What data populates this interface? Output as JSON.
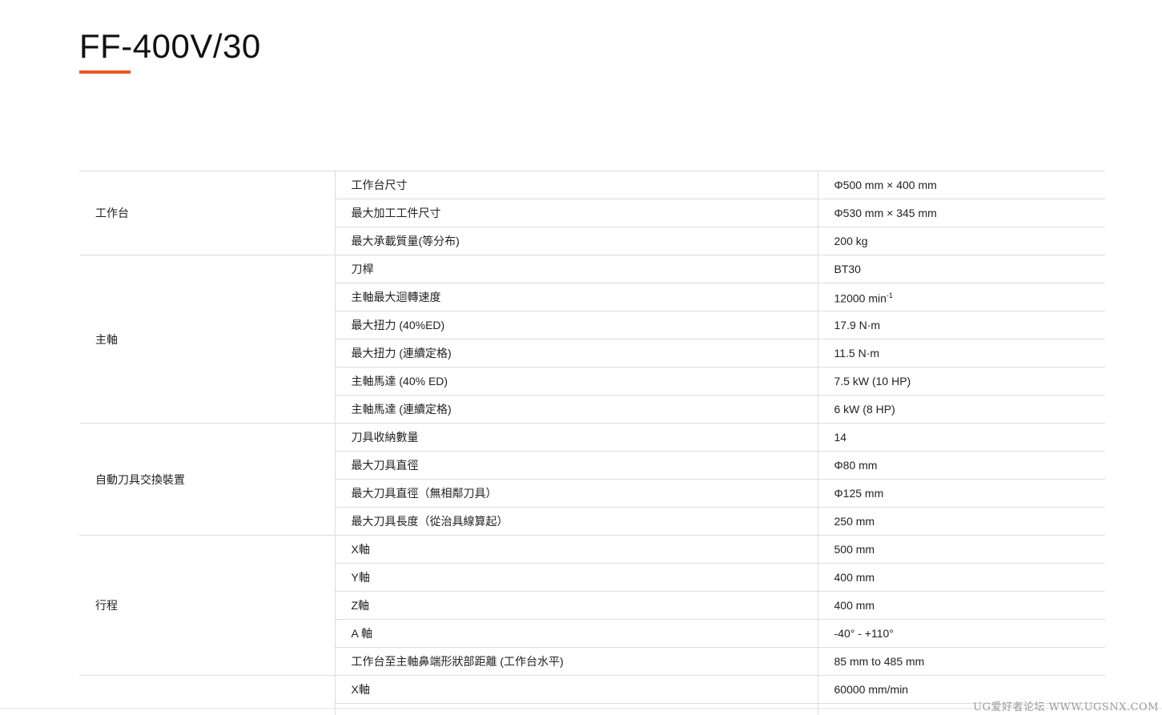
{
  "page": {
    "title": "FF-400V/30",
    "accent_color": "#e8581e"
  },
  "spec_table": {
    "groups": [
      {
        "category": "工作台",
        "rows": [
          {
            "item": "工作台尺寸",
            "value": "Φ500 mm × 400 mm"
          },
          {
            "item": "最大加工工件尺寸",
            "value": "Φ530 mm × 345 mm"
          },
          {
            "item": "最大承載質量(等分布)",
            "value": "200 kg"
          }
        ]
      },
      {
        "category": "主軸",
        "rows": [
          {
            "item": "刀桿",
            "value": "BT30"
          },
          {
            "item": "主軸最大迴轉速度",
            "value": "12000 min",
            "sup": "-1"
          },
          {
            "item": "最大扭力 (40%ED)",
            "value": "17.9 N·m"
          },
          {
            "item": "最大扭力 (連續定格)",
            "value": "11.5 N·m"
          },
          {
            "item": "主軸馬達 (40% ED)",
            "value": "7.5 kW (10 HP)"
          },
          {
            "item": "主軸馬達 (連續定格)",
            "value": "6 kW (8 HP)"
          }
        ]
      },
      {
        "category": "自動刀具交換裝置",
        "rows": [
          {
            "item": "刀具收納數量",
            "value": "14"
          },
          {
            "item": "最大刀具直徑",
            "value": "Φ80 mm"
          },
          {
            "item": "最大刀具直徑（無相鄰刀具）",
            "value": "Φ125 mm"
          },
          {
            "item": "最大刀具長度（從治具線算起）",
            "value": "250 mm"
          }
        ]
      },
      {
        "category": "行程",
        "rows": [
          {
            "item": "X軸",
            "value": "500 mm"
          },
          {
            "item": "Y軸",
            "value": "400 mm"
          },
          {
            "item": "Z軸",
            "value": "400 mm"
          },
          {
            "item": "A 軸",
            "value": "-40° - +110°"
          },
          {
            "item": "工作台至主軸鼻端形狀部距離 (工作台水平)",
            "value": "85 mm to 485 mm"
          }
        ]
      },
      {
        "category": "",
        "rows": [
          {
            "item": "X軸",
            "value": "60000 mm/min"
          },
          {
            "item": "",
            "value": ""
          }
        ]
      }
    ]
  },
  "watermark": "UG爱好者论坛 WWW.UGSNX.COM"
}
